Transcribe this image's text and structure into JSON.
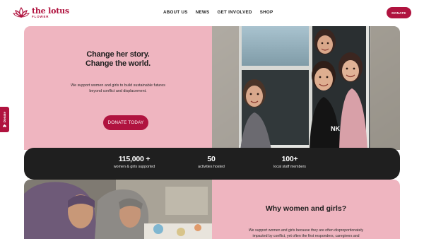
{
  "brand": {
    "title": "the lotus",
    "subtitle": "FLOWER",
    "color": "#b0133f"
  },
  "nav": {
    "items": [
      "ABOUT US",
      "NEWS",
      "GET INVOLVED",
      "SHOP"
    ]
  },
  "header": {
    "donate_label": "DONATE"
  },
  "side_tab": {
    "label": "Donate"
  },
  "hero": {
    "title_line1": "Change her story.",
    "title_line2": "Change the world.",
    "text": "We support women and girls to build sustainable futures beyond conflict and displacement.",
    "button": "DONATE TODAY"
  },
  "stats": [
    {
      "value": "115,000 +",
      "label": "women & girls supported"
    },
    {
      "value": "50",
      "label": "activities hosted"
    },
    {
      "value": "100+",
      "label": "local staff members"
    }
  ],
  "why": {
    "title": "Why women and girls?",
    "text": "We support women and girls because they are often disproportionately impacted by conflict, yet often the first responders, caregivers and"
  },
  "colors": {
    "accent": "#b0133f",
    "pink": "#efb5c0",
    "dark": "#1f1f1f"
  }
}
